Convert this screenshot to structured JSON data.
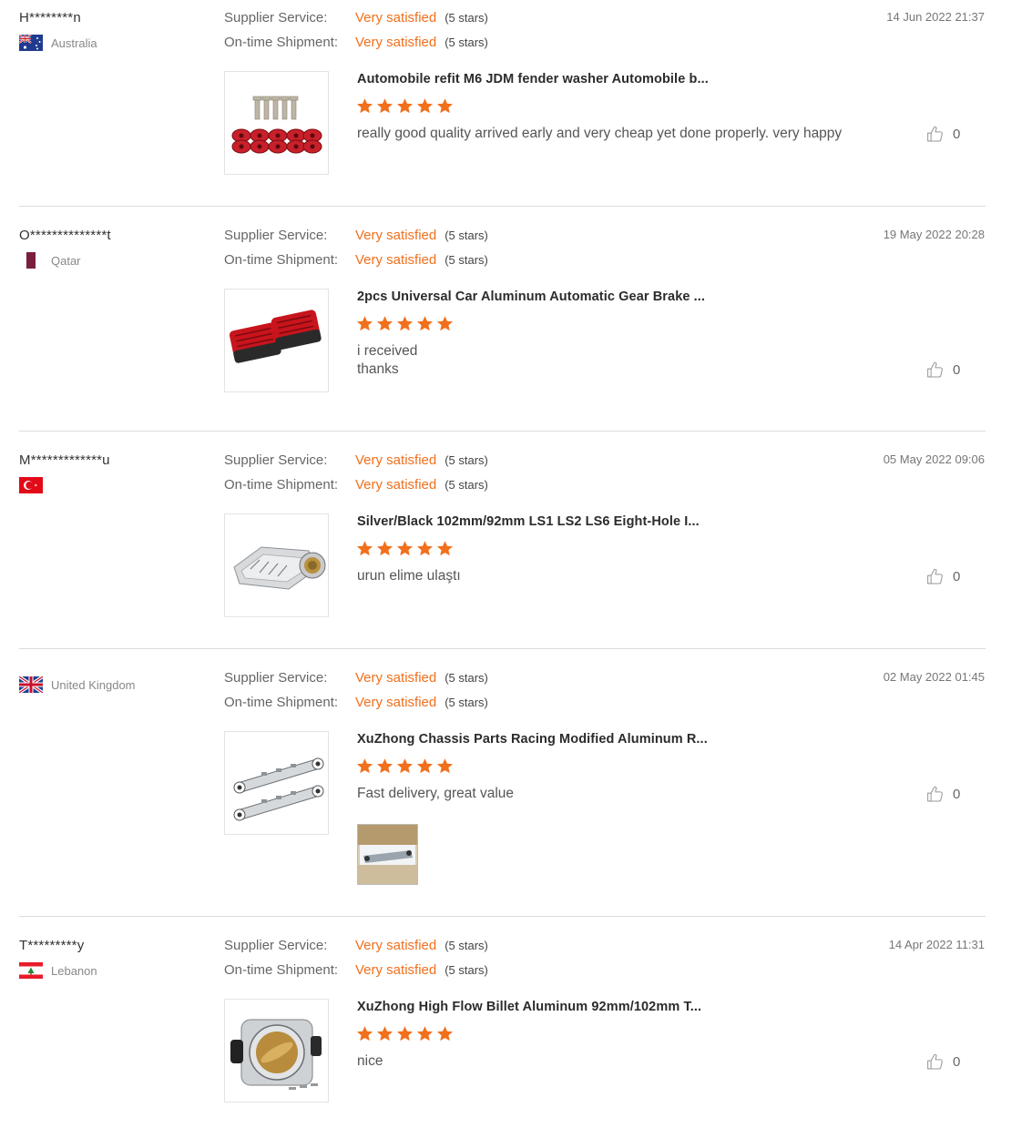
{
  "labels": {
    "supplier_service": "Supplier Service:",
    "ontime_shipment": "On-time Shipment:"
  },
  "colors": {
    "accent": "#f26f1b",
    "divider": "#dcdcdc"
  },
  "reviews": [
    {
      "buyer": "H********n",
      "country": "Australia",
      "flag": "australia-flag-icon",
      "date": "14 Jun 2022 21:37",
      "supplier_value": "Very satisfied",
      "supplier_stars": "(5 stars)",
      "shipment_value": "Very satisfied",
      "shipment_stars": "(5 stars)",
      "product_title": "Automobile refit M6 JDM fender washer Automobile b...",
      "rating": 5,
      "text": "really good quality arrived early and very cheap yet done properly. very happy",
      "likes": "0"
    },
    {
      "buyer": "O**************t",
      "country": "Qatar",
      "flag": "qatar-flag-icon",
      "date": "19 May 2022 20:28",
      "supplier_value": "Very satisfied",
      "supplier_stars": "(5 stars)",
      "shipment_value": "Very satisfied",
      "shipment_stars": "(5 stars)",
      "product_title": "2pcs Universal Car Aluminum Automatic Gear Brake ...",
      "rating": 5,
      "text_line1": "i received",
      "text_line2": "thanks",
      "likes": "0"
    },
    {
      "buyer": "M*************u",
      "country": "",
      "flag": "turkey-flag-icon",
      "date": "05 May 2022 09:06",
      "supplier_value": "Very satisfied",
      "supplier_stars": "(5 stars)",
      "shipment_value": "Very satisfied",
      "shipment_stars": "(5 stars)",
      "product_title": "Silver/Black 102mm/92mm LS1 LS2 LS6 Eight-Hole I...",
      "rating": 5,
      "text": "urun elime ulaştı",
      "likes": "0"
    },
    {
      "buyer": "",
      "country": "United Kingdom",
      "flag": "uk-flag-icon",
      "date": "02 May 2022 01:45",
      "supplier_value": "Very satisfied",
      "supplier_stars": "(5 stars)",
      "shipment_value": "Very satisfied",
      "shipment_stars": "(5 stars)",
      "product_title": "XuZhong Chassis Parts Racing Modified Aluminum R...",
      "rating": 5,
      "text": "Fast delivery, great value",
      "likes": "0"
    },
    {
      "buyer": "T*********y",
      "country": "Lebanon",
      "flag": "lebanon-flag-icon",
      "date": "14 Apr 2022 11:31",
      "supplier_value": "Very satisfied",
      "supplier_stars": "(5 stars)",
      "shipment_value": "Very satisfied",
      "shipment_stars": "(5 stars)",
      "product_title": "XuZhong High Flow Billet Aluminum 92mm/102mm T...",
      "rating": 5,
      "text": "nice",
      "likes": "0"
    }
  ]
}
